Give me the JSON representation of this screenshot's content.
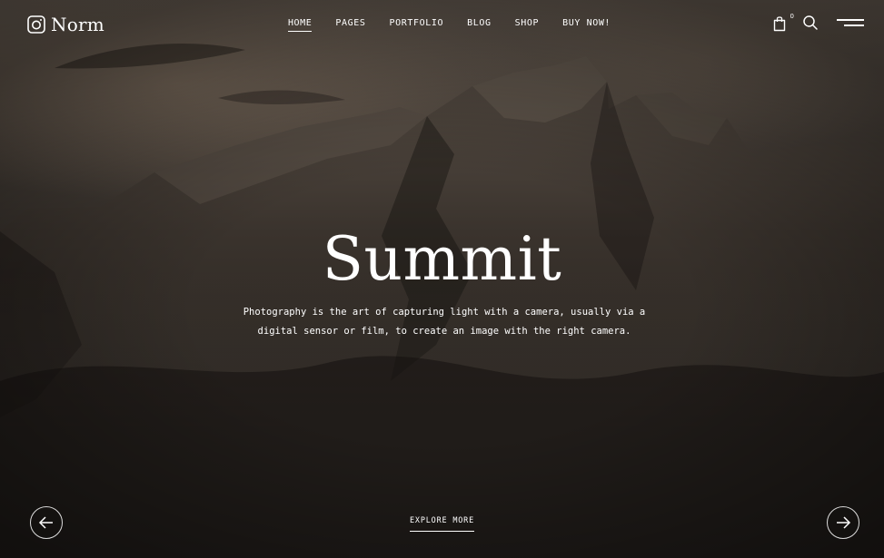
{
  "brand": {
    "name": "Norm",
    "logo_icon": "camera-icon"
  },
  "nav": {
    "items": [
      {
        "label": "HOME",
        "active": true
      },
      {
        "label": "PAGES",
        "active": false
      },
      {
        "label": "PORTFOLIO",
        "active": false
      },
      {
        "label": "BLOG",
        "active": false
      },
      {
        "label": "SHOP",
        "active": false
      },
      {
        "label": "BUY NOW!",
        "active": false
      }
    ]
  },
  "header_tools": {
    "cart_icon": "shopping-bag-icon",
    "cart_count": "0",
    "search_icon": "search-icon",
    "menu_icon": "hamburger-menu-icon"
  },
  "hero": {
    "title": "Summit",
    "description": "Photography is the art of capturing light with a camera, usually via a digital sensor or film, to create an image with the right camera.",
    "cta_label": "EXPLORE MORE",
    "prev_icon": "arrow-left-icon",
    "next_icon": "arrow-right-icon"
  },
  "colors": {
    "text": "#ffffff",
    "background": "#1a1714"
  }
}
